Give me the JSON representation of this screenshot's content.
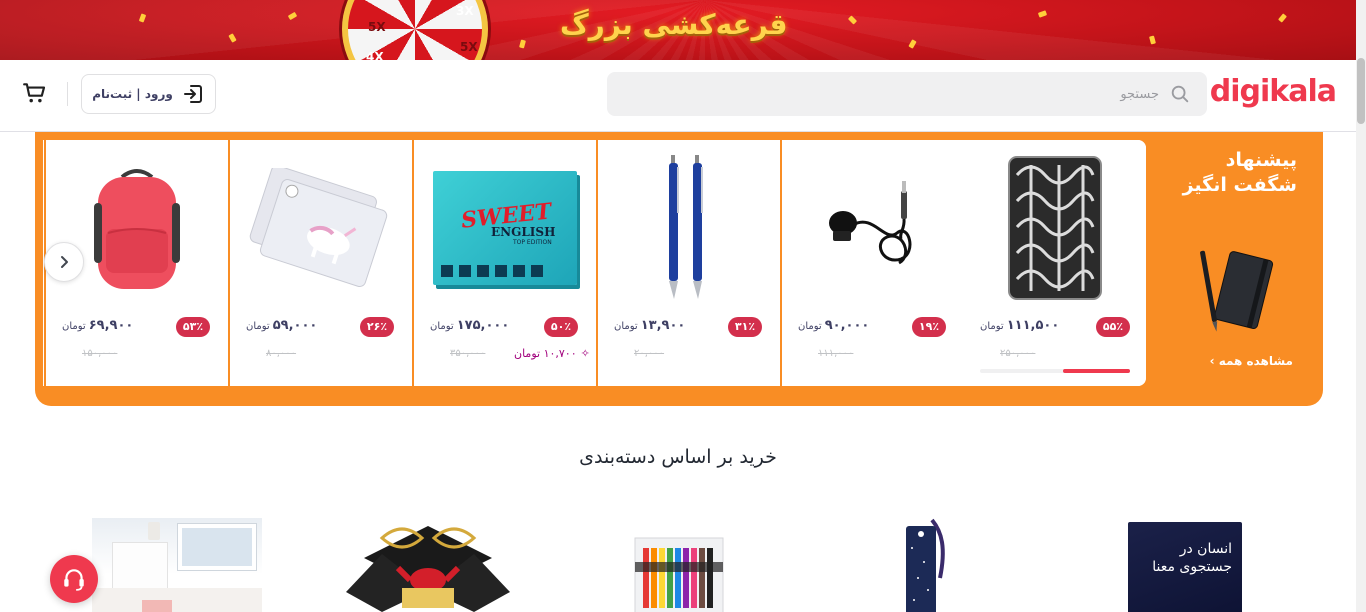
{
  "banner": {
    "promo_text": "قرعه‌کشی بزرگ",
    "wheel_labels": [
      "5X",
      "3X",
      "5X",
      "4X"
    ]
  },
  "header": {
    "logo": "digikala",
    "search_placeholder": "جستجو",
    "login_label": "ورود | ثبت‌نام"
  },
  "amazing": {
    "title": "پیشنهاد شگفت انگیز",
    "see_all": "مشاهده همه",
    "currency": "تومان",
    "products": [
      {
        "name": "فرش",
        "discount": "۵۵٪",
        "price": "۱۱۱,۵۰۰",
        "old_price": "۲۵۰,۰۰۰",
        "sold_fraction": 0.45
      },
      {
        "name": "میکروفون یقه‌ای",
        "discount": "۱۹٪",
        "price": "۹۰,۰۰۰",
        "old_price": "۱۱۱,۰۰۰"
      },
      {
        "name": "خودکار آبی",
        "discount": "۳۱٪",
        "price": "۱۳,۹۰۰",
        "old_price": "۲۰,۰۰۰"
      },
      {
        "name": "بسته آموزش زبان انگلیسی",
        "discount": "۵۰٪",
        "price": "۱۷۵,۰۰۰",
        "old_price": "۳۵۰,۰۰۰",
        "club_price": "۱۰,۷۰۰"
      },
      {
        "name": "کاور پلاستیکی",
        "discount": "۲۶٪",
        "price": "۵۹,۰۰۰",
        "old_price": "۸۰,۰۰۰"
      },
      {
        "name": "کوله پشتی صورتی",
        "discount": "۵۳٪",
        "price": "۶۹,۹۰۰",
        "old_price": "۱۵۰,۰۰۰"
      }
    ],
    "box_texts": {
      "line1": "SWEET",
      "line2": "ENGLISH",
      "line3": "TOP EDITION"
    }
  },
  "categories": {
    "title": "خرید بر اساس دسته‌بندی",
    "book_text": "انسان در جستجوی معنا"
  },
  "colors": {
    "brand": "#ef394e",
    "amazing": "#f98d24",
    "club": "#a1007d"
  }
}
